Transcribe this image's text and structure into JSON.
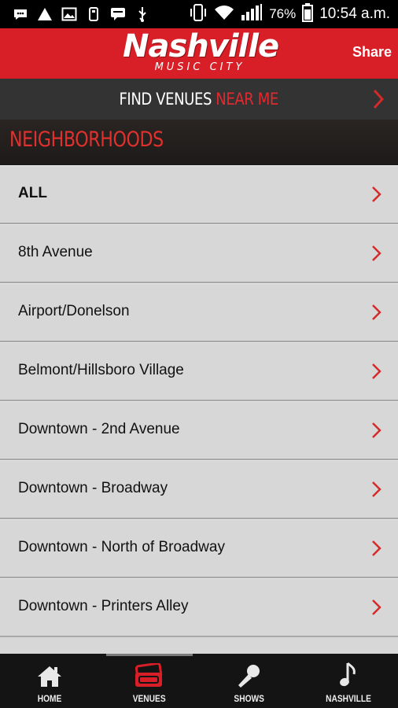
{
  "status_bar": {
    "battery_percent": "76%",
    "time": "10:54 a.m.",
    "icons": [
      "message-icon",
      "warning-icon",
      "image-icon",
      "usb-icon",
      "chat-icon",
      "usb-icon",
      "vibrate-icon",
      "wifi-icon",
      "signal-icon",
      "battery-icon"
    ]
  },
  "header": {
    "logo_main": "Nashville",
    "logo_sub": "MUSIC CITY",
    "share_label": "Share",
    "brand_color": "#d81f27"
  },
  "find_bar": {
    "label_main": "FIND VENUES",
    "label_accent": "NEAR ME"
  },
  "section": {
    "title": "NEIGHBORHOODS"
  },
  "neighborhoods": [
    "ALL",
    "8th Avenue",
    "Airport/Donelson",
    "Belmont/Hillsboro Village",
    "Downtown - 2nd Avenue",
    "Downtown - Broadway",
    "Downtown - North of Broadway",
    "Downtown - Printers Alley"
  ],
  "tabs": [
    {
      "label": "HOME",
      "icon": "home-icon",
      "active": false
    },
    {
      "label": "VENUES",
      "icon": "ticket-icon",
      "active": true
    },
    {
      "label": "SHOWS",
      "icon": "microphone-icon",
      "active": false
    },
    {
      "label": "NASHVILLE",
      "icon": "music-note-icon",
      "active": false
    }
  ],
  "colors": {
    "accent": "#d81f27",
    "chevron": "#d42a2a"
  }
}
